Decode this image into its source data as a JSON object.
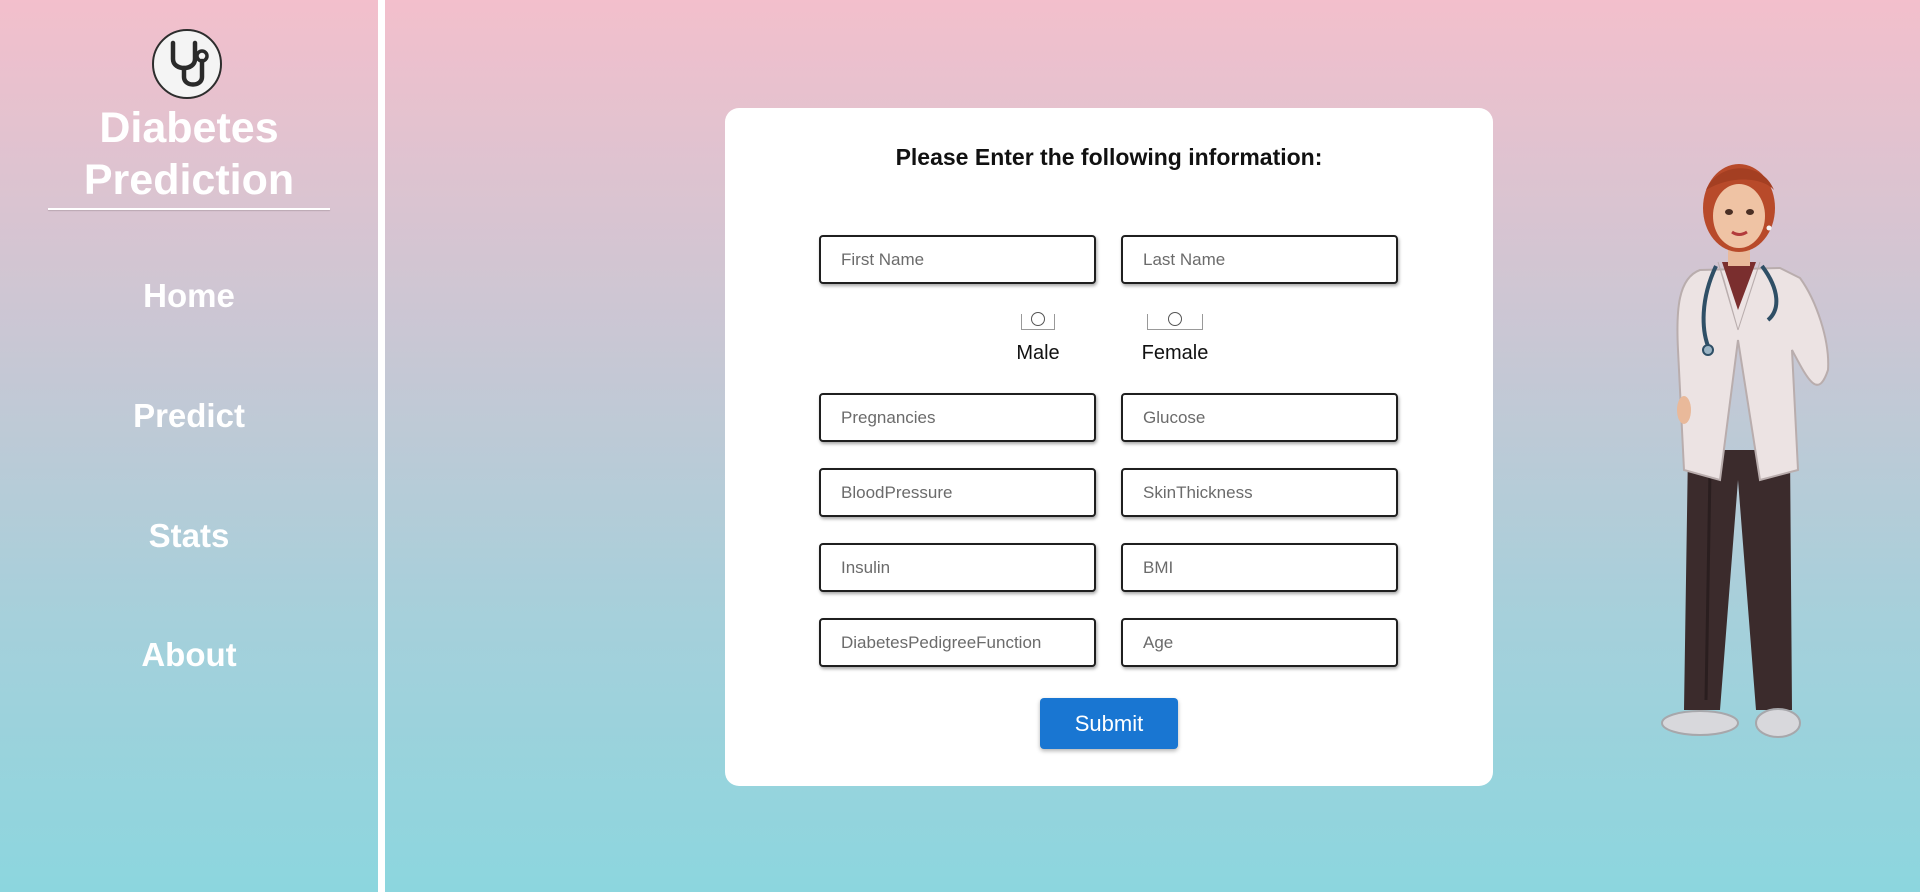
{
  "sidebar": {
    "logo_icon": "stethoscope-icon",
    "brand_line1": "Diabetes",
    "brand_line2": "Prediction",
    "nav": [
      {
        "label": "Home"
      },
      {
        "label": "Predict"
      },
      {
        "label": "Stats"
      },
      {
        "label": "About"
      }
    ]
  },
  "form": {
    "title": "Please Enter the following information:",
    "first_name": {
      "placeholder": "First Name",
      "value": ""
    },
    "last_name": {
      "placeholder": "Last Name",
      "value": ""
    },
    "gender": {
      "options": [
        {
          "label": "Male",
          "checked": false
        },
        {
          "label": "Female",
          "checked": false
        }
      ]
    },
    "pregnancies": {
      "placeholder": "Pregnancies",
      "value": ""
    },
    "glucose": {
      "placeholder": "Glucose",
      "value": ""
    },
    "blood_pressure": {
      "placeholder": "BloodPressure",
      "value": ""
    },
    "skin_thickness": {
      "placeholder": "SkinThickness",
      "value": ""
    },
    "insulin": {
      "placeholder": "Insulin",
      "value": ""
    },
    "bmi": {
      "placeholder": "BMI",
      "value": ""
    },
    "dpf": {
      "placeholder": "DiabetesPedigreeFunction",
      "value": ""
    },
    "age": {
      "placeholder": "Age",
      "value": ""
    },
    "submit_label": "Submit"
  },
  "colors": {
    "gradient_top": "#f3bfcc",
    "gradient_bottom": "#8cd6de",
    "submit_button": "#1976d2",
    "card_background": "#ffffff"
  },
  "illustration": {
    "icon": "doctor-illustration"
  }
}
